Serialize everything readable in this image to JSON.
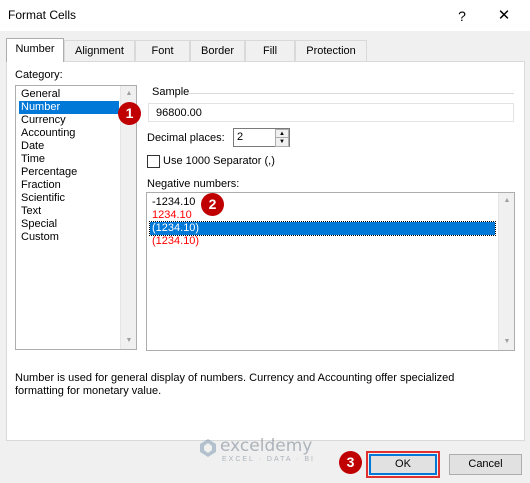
{
  "window": {
    "title": "Format Cells",
    "help_label": "?",
    "close_label": "✕"
  },
  "tabs": [
    {
      "label": "Number",
      "active": true
    },
    {
      "label": "Alignment",
      "active": false
    },
    {
      "label": "Font",
      "active": false
    },
    {
      "label": "Border",
      "active": false
    },
    {
      "label": "Fill",
      "active": false
    },
    {
      "label": "Protection",
      "active": false
    }
  ],
  "category": {
    "label": "Category:",
    "items": [
      "General",
      "Number",
      "Currency",
      "Accounting",
      "Date",
      "Time",
      "Percentage",
      "Fraction",
      "Scientific",
      "Text",
      "Special",
      "Custom"
    ],
    "selected": "Number"
  },
  "sample": {
    "label": "Sample",
    "value": "96800.00"
  },
  "decimal_places": {
    "label": "Decimal places:",
    "value": "2"
  },
  "separator": {
    "label": "Use 1000 Separator (,)",
    "checked": false
  },
  "negative_numbers": {
    "label": "Negative numbers:",
    "items": [
      {
        "text": "-1234.10",
        "red": false
      },
      {
        "text": "1234.10",
        "red": true
      },
      {
        "text": "(1234.10)",
        "red": false
      },
      {
        "text": "(1234.10)",
        "red": true
      }
    ],
    "selected_index": 2
  },
  "description": {
    "line1": "Number is used for general display of numbers.  Currency and Accounting offer specialized",
    "line2": "formatting for monetary value."
  },
  "buttons": {
    "ok": "OK",
    "cancel": "Cancel"
  },
  "callouts": [
    "1",
    "2",
    "3"
  ],
  "watermark": {
    "name": "exceldemy",
    "tagline": "EXCEL · DATA · BI"
  },
  "colors": {
    "selection": "#0078d7",
    "negative_red": "#ff0000",
    "callout": "#c00000"
  }
}
